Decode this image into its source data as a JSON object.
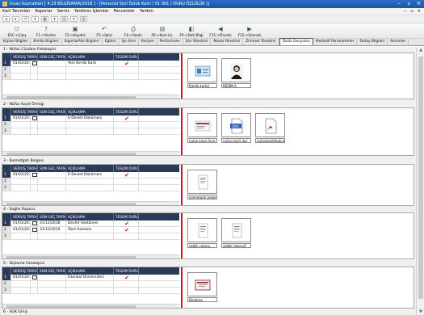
{
  "window": {
    "title": "İnsan Kaynakları [ 4.19 BİLGİSAYAR/2018 ] - [Personel Sicil Özlük Kartı ( 01 001 / DURU ÖZLÜLÜK )]",
    "controls": [
      "‒",
      "▫",
      "✕"
    ]
  },
  "menu": {
    "items": [
      "Kart Tanımları",
      "Raporlar",
      "Servis",
      "Yardımcı İşlemler",
      "Pencereler",
      "Yardım"
    ],
    "mdi_controls": [
      "‒",
      "▫",
      "✕"
    ]
  },
  "quickbar": {
    "buttons": [
      "◂",
      "▸",
      "↺",
      "▾",
      "▦",
      "▾",
      "▤",
      "▾",
      "▥"
    ]
  },
  "toolbar": {
    "buttons": [
      {
        "label": "ESC->Çıkış",
        "icon": "⎋"
      },
      {
        "label": "F1->Yardım",
        "icon": "?"
      },
      {
        "label": "F2->Kaydet",
        "icon": "▣"
      },
      {
        "label": "F3->İptal",
        "icon": "↶"
      },
      {
        "label": "F4->Yazdır",
        "icon": "⎙"
      },
      {
        "label": "F6->Kart Lis.",
        "icon": "▤"
      },
      {
        "label": "F9->Detl.Bilgi",
        "icon": "◧"
      },
      {
        "label": "F11->Önceki",
        "icon": "◀"
      },
      {
        "label": "F12->Sonraki",
        "icon": "▶"
      }
    ]
  },
  "tabs": {
    "items": [
      "Kişisel Bilgiler",
      "Kimlik Bilgileri",
      "Sigorta/Aile Bilgileri",
      "Eğitim",
      "İşe Alım",
      "Kariyer",
      "Performans",
      "İzin Yönetimi",
      "Mesai Yönetimi",
      "Zimmet Yönetimi",
      "Özlük Dosyaları",
      "Muhtelif Parametreler",
      "Detay Bilgileri",
      "Resimler"
    ],
    "active": "Özlük Dosyaları"
  },
  "grid_columns": [
    "VERİLİŞ TARİHİ",
    "SON GEÇ.TARİH",
    "AÇIKLAMA",
    "TESLİM DURUMU"
  ],
  "sections": [
    {
      "title": "1 - Nüfus Cüzdanı Fotokopisi",
      "rows": [
        {
          "n": "1",
          "date": "01/01/2018",
          "end": "",
          "desc": "Yeni Kimlik Kartı",
          "check": true
        },
        {
          "n": "2",
          "date": "",
          "end": "",
          "desc": "",
          "check": false
        },
        {
          "n": "3",
          "date": "",
          "end": "",
          "desc": "",
          "check": false
        }
      ],
      "docs": [
        {
          "caption": "Kimlik kartı2",
          "kind": "card"
        },
        {
          "caption": "RESİM-A",
          "kind": "photo"
        }
      ]
    },
    {
      "title": "2 - Nüfus Kayıt Örneği",
      "rows": [
        {
          "n": "1",
          "date": "01/01/2018",
          "end": "",
          "desc": "E-Devlet Dokümanı",
          "check": true
        },
        {
          "n": "2",
          "date": "",
          "end": "",
          "desc": "",
          "check": false
        },
        {
          "n": "3",
          "date": "",
          "end": "",
          "desc": "",
          "check": false
        }
      ],
      "docs": [
        {
          "caption": "nufus kayit örne",
          "kind": "red"
        },
        {
          "caption": "nufus kayit doc",
          "kind": "doc"
        },
        {
          "caption": "nufuskayitfıkub.pr",
          "kind": "pdf"
        }
      ]
    },
    {
      "title": "3 - İkametgah Belgesi",
      "rows": [
        {
          "n": "1",
          "date": "01/01/2018",
          "end": "",
          "desc": "E-Devlet Dokümanı",
          "check": true
        },
        {
          "n": "2",
          "date": "",
          "end": "",
          "desc": "",
          "check": false
        },
        {
          "n": "3",
          "date": "",
          "end": "",
          "desc": "",
          "check": false
        }
      ],
      "docs": [
        {
          "caption": "ikametgah belge",
          "kind": "paper"
        }
      ]
    },
    {
      "title": "4 - Sağlık Raporu",
      "rows": [
        {
          "n": "1",
          "date": "01/01/2018",
          "end": "31/12/2018",
          "desc": "Devlet Hastanesi",
          "check": true
        },
        {
          "n": "2",
          "date": "01/01/2019",
          "end": "31/12/2019",
          "desc": "Özel Hastane",
          "check": true
        },
        {
          "n": "3",
          "date": "",
          "end": "",
          "desc": "",
          "check": false
        }
      ],
      "docs": [
        {
          "caption": "sağlık raporu",
          "kind": "paper"
        },
        {
          "caption": "sağlık raporu2",
          "kind": "paper"
        }
      ]
    },
    {
      "title": "5 - Diploma Fotokopisi",
      "rows": [
        {
          "n": "1",
          "date": "01/01/2018",
          "end": "",
          "desc": "İstanbul Üniversitesi",
          "check": true
        },
        {
          "n": "2",
          "date": "",
          "end": "",
          "desc": "",
          "check": false
        },
        {
          "n": "3",
          "date": "",
          "end": "",
          "desc": "",
          "check": false
        }
      ],
      "docs": [
        {
          "caption": "Diploma",
          "kind": "diploma"
        }
      ]
    },
    {
      "title": "6 - SGK Girişi",
      "rows": [],
      "docs": []
    }
  ],
  "colors": {
    "title_blue": "#1b56a8",
    "grid_header": "#2c3a5a",
    "accent_red": "#d0101a"
  }
}
